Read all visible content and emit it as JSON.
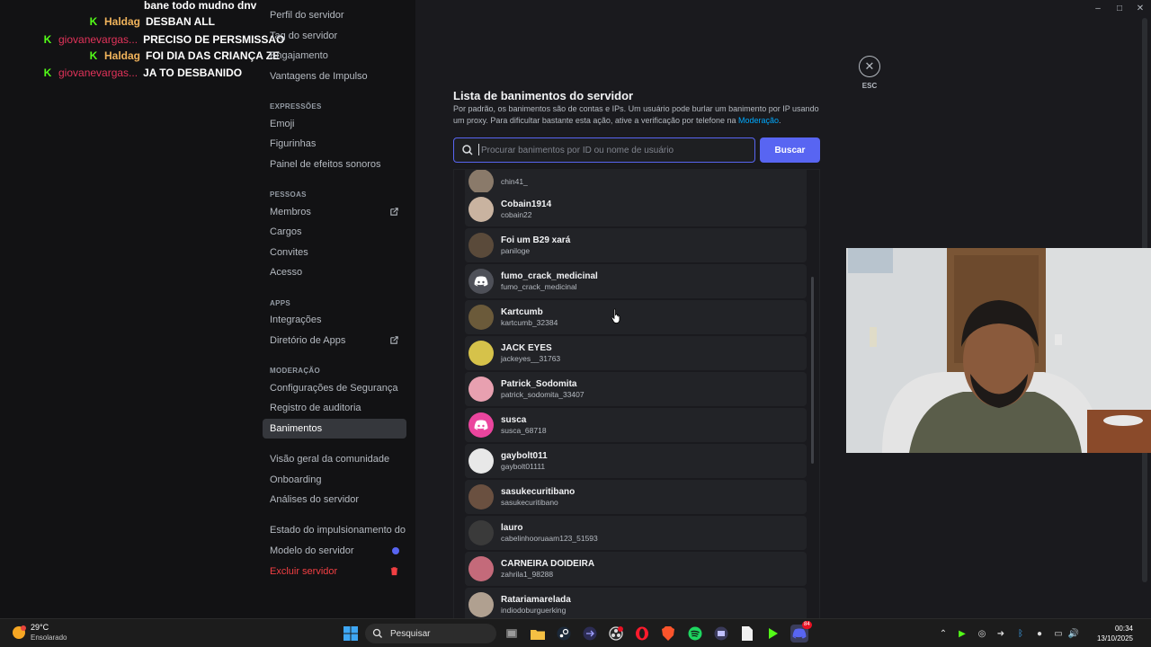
{
  "chat": [
    {
      "user": "",
      "message": "bane todo mudno dnv",
      "user_color": "#ffd166",
      "badge": ""
    },
    {
      "user": "Haldag",
      "message": "DESBAN ALL",
      "user_color": "#f0b35b",
      "badge": "kick-icon"
    },
    {
      "user": "giovanevargas...",
      "message": "PRECISO DE PERSMISSAO",
      "user_color": "#e2335a",
      "badge": "kick-icon"
    },
    {
      "user": "Haldag",
      "message": "FOI DIA DAS CRIANÇA ZE",
      "user_color": "#f0b35b",
      "badge": "kick-icon"
    },
    {
      "user": "giovanevargas...",
      "message": "JA TO DESBANIDO",
      "user_color": "#e2335a",
      "badge": "kick-icon"
    }
  ],
  "menu": {
    "items": [
      {
        "label": "Perfil do servidor"
      },
      {
        "label": "Tag do servidor"
      },
      {
        "label": "Engajamento"
      },
      {
        "label": "Vantagens de Impulso"
      }
    ],
    "sections": [
      {
        "heading": "EXPRESSÕES",
        "items": [
          {
            "label": "Emoji"
          },
          {
            "label": "Figurinhas"
          },
          {
            "label": "Painel de efeitos sonoros"
          }
        ]
      },
      {
        "heading": "PESSOAS",
        "items": [
          {
            "label": "Membros"
          },
          {
            "label": "Cargos"
          },
          {
            "label": "Convites"
          },
          {
            "label": "Acesso"
          }
        ]
      },
      {
        "heading": "APPS",
        "items": [
          {
            "label": "Integrações"
          },
          {
            "label": "Diretório de Apps"
          }
        ]
      },
      {
        "heading": "MODERAÇÃO",
        "items": [
          {
            "label": "Configurações de Segurança"
          },
          {
            "label": "Registro de auditoria"
          },
          {
            "label": "Banimentos"
          }
        ]
      }
    ],
    "community": [
      {
        "label": "Visão geral da comunidade"
      },
      {
        "label": "Onboarding"
      },
      {
        "label": "Análises do servidor"
      }
    ],
    "bottom": [
      {
        "label": "Estado do impulsionamento do servidor"
      },
      {
        "label": "Modelo do servidor"
      },
      {
        "label": "Excluir servidor"
      }
    ]
  },
  "close": {
    "label": "ESC"
  },
  "bans": {
    "title": "Lista de banimentos do servidor",
    "description_prefix": "Por padrão, os banimentos são de contas e IPs. Um usuário pode burlar um banimento por IP usando um proxy. Para dificultar bastante esta ação, ative a verificação por telefone na ",
    "description_link": "Moderação",
    "description_suffix": ".",
    "search_placeholder": "Procurar banimentos por ID ou nome de usuário",
    "search_button": "Buscar",
    "list": [
      {
        "name": "",
        "username": "chin41_",
        "avatar": "photo-avatar",
        "color": "#8a7a6a"
      },
      {
        "name": "Cobain1914",
        "username": "cobain22",
        "avatar": "photo-avatar",
        "color": "#c9b3a0"
      },
      {
        "name": "Foi um B29 xará",
        "username": "paniloge",
        "avatar": "photo-avatar",
        "color": "#5a4a3a"
      },
      {
        "name": "fumo_crack_medicinal",
        "username": "fumo_crack_medicinal",
        "avatar": "discord-avatar",
        "color": "#4e5058"
      },
      {
        "name": "Kartcumb",
        "username": "kartcumb_32384",
        "avatar": "photo-avatar",
        "color": "#6b5a3a"
      },
      {
        "name": "JACK EYES",
        "username": "jackeyes__31763",
        "avatar": "photo-avatar",
        "color": "#d6c24a"
      },
      {
        "name": "Patrick_Sodomita",
        "username": "patrick_sodomita_33407",
        "avatar": "photo-avatar",
        "color": "#e8a0b0"
      },
      {
        "name": "susca",
        "username": "susca_68718",
        "avatar": "discord-avatar",
        "color": "#eb459e"
      },
      {
        "name": "gaybolt011",
        "username": "gaybolt01111",
        "avatar": "photo-avatar",
        "color": "#e8e8e8"
      },
      {
        "name": "sasukecuritibano",
        "username": "sasukecuritibano",
        "avatar": "photo-avatar",
        "color": "#6a5040"
      },
      {
        "name": "lauro",
        "username": "cabelinhooruaam123_51593",
        "avatar": "photo-avatar",
        "color": "#3a3a3a"
      },
      {
        "name": "CARNEIRA DOIDEIRA",
        "username": "zahrila1_98288",
        "avatar": "photo-avatar",
        "color": "#c46a7a"
      },
      {
        "name": "Ratariamarelada",
        "username": "indiodoburguerking",
        "avatar": "photo-avatar",
        "color": "#b0a090"
      }
    ]
  },
  "taskbar": {
    "weather_temp": "29°C",
    "weather_cond": "Ensolarado",
    "search_label": "Pesquisar",
    "time": "00:34",
    "date": "13/10/2025",
    "discord_badge": "84"
  }
}
